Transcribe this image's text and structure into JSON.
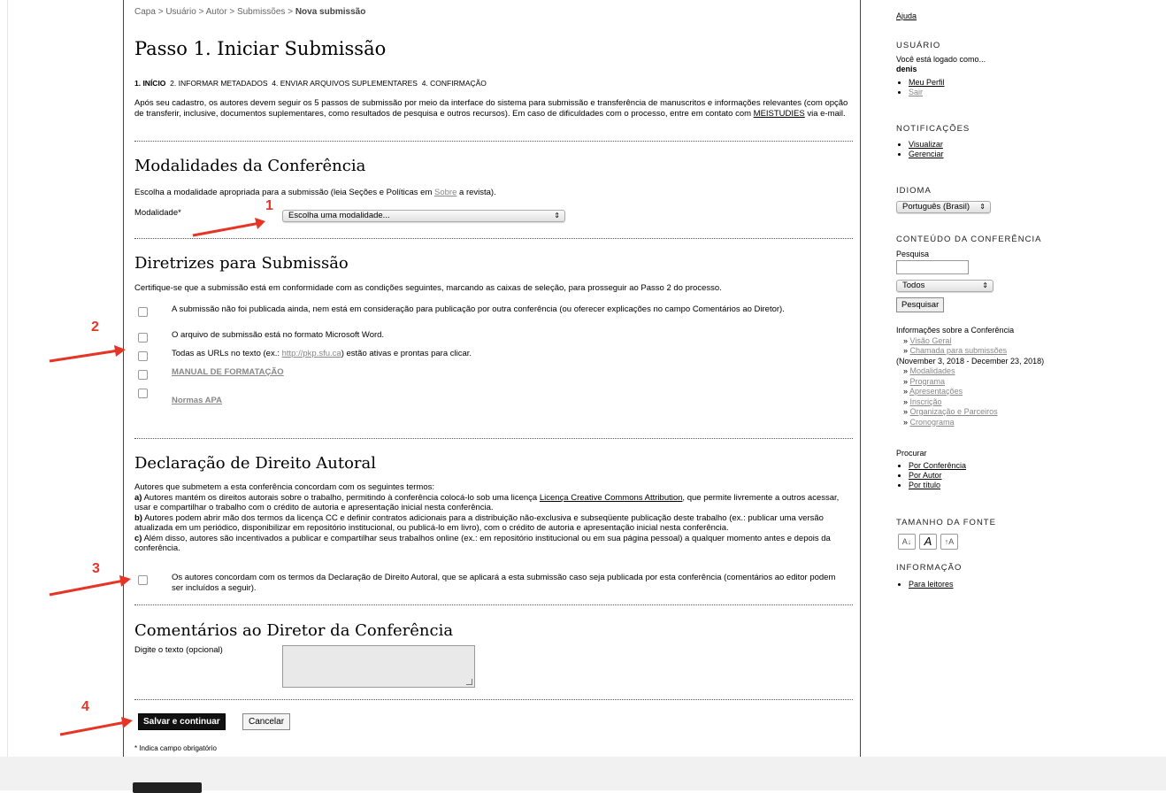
{
  "breadcrumb": {
    "c1": "Capa",
    "c2": "Usuário",
    "c3": "Autor",
    "c4": "Submissões",
    "current": "Nova submissão",
    "sep": ">"
  },
  "title": "Passo 1. Iniciar Submissão",
  "steps": {
    "s1": "1. INÍCIO",
    "s2": "2. INFORMAR METADADOS",
    "s3": "4. ENVIAR ARQUIVOS SUPLEMENTARES",
    "s4": "4. CONFIRMAÇÃO"
  },
  "intro": {
    "text1": "Após seu cadastro, os autores devem seguir os 5 passos de submissão por meio da interface do sistema para submissão e transferência de manuscritos e informações relevantes (com opção de transferir, inclusive, documentos suplementares, como resultados de pesquisa e outros recursos). Em caso de dificuldades com o processo, entre em contato com ",
    "link": "MEISTUDIES",
    "text2": " via e-mail."
  },
  "modalidades": {
    "heading": "Modalidades da Conferência",
    "text1": "Escolha a modalidade apropriada para a submissão (leia Seções e Políticas em ",
    "link": "Sobre",
    "text2": " a revista).",
    "label": "Modalidade*",
    "select_value": "Escolha uma modalidade..."
  },
  "diretrizes": {
    "heading": "Diretrizes para Submissão",
    "text": "Certifique-se que a submissão está em conformidade com as condições seguintes, marcando as caixas de seleção, para prosseguir ao Passo 2 do processo.",
    "item1": "A submissão não foi publicada ainda, nem está em consideração para publicação por outra conferência (ou oferecer explicações no campo Comentários ao Diretor).",
    "item2": "O arquivo de submissão está no formato Microsoft Word.",
    "item3a": "Todas as URLs no texto (ex.: ",
    "item3link": "http://pkp.sfu.ca",
    "item3b": ") estão ativas e prontas para clicar.",
    "item4": "MANUAL DE FORMATAÇÃO",
    "item5": "Normas APA"
  },
  "copyright": {
    "heading": "Declaração de Direito Autoral",
    "intro": "Autores que submetem a esta conferência concordam com os seguintes termos:",
    "a_label": "a)",
    "a_text1": " Autores mantém os direitos autorais sobre o trabalho, permitindo à conferência colocá-lo sob uma licença ",
    "a_link": "Licença Creative Commons Attribution",
    "a_text2": ", que permite livremente a outros acessar, usar e compartilhar o trabalho com o crédito de autoria e apresentação inicial nesta conferência.",
    "b_label": "b)",
    "b_text": " Autores podem abrir mão dos termos da licença CC e definir contratos adicionais para a distribuição não-exclusiva e subseqüente publicação deste trabalho (ex.: publicar uma versão atualizada em um periódico, disponibilizar em repositório institucional, ou publicá-lo em livro), com o crédito de autoria e apresentação inicial nesta conferência.",
    "c_label": "c)",
    "c_text": " Além disso, autores são incentivados a publicar e compartilhar seus trabalhos online (ex.: em repositório institucional ou em sua página pessoal) a qualquer momento antes e depois da conferência.",
    "agree": "Os autores concordam com os termos da Declaração de Direito Autoral, que se aplicará a esta submissão caso seja publicada por esta conferência (comentários ao editor podem ser incluídos a seguir)."
  },
  "comments": {
    "heading": "Comentários ao Diretor da Conferência",
    "label": "Digite o texto (opcional)"
  },
  "buttons": {
    "save": "Salvar e continuar",
    "cancel": "Cancelar"
  },
  "required_note": "* Indica campo obrigatório",
  "annotations": {
    "n1": "1",
    "n2": "2",
    "n3": "3",
    "n4": "4",
    "color": "#e53527"
  },
  "sidebar": {
    "help": "Ajuda",
    "user_head": "USUÁRIO",
    "logged": "Você está logado como...",
    "username": "denis",
    "profile": "Meu Perfil",
    "logout": "Sair",
    "notif_head": "NOTIFICAÇÕES",
    "view": "Visualizar",
    "manage": "Gerenciar",
    "lang_head": "IDIOMA",
    "lang_value": "Português (Brasil)",
    "content_head": "CONTEÚDO DA CONFERÊNCIA",
    "search_label": "Pesquisa",
    "search_scope": "Todos",
    "search_button": "Pesquisar",
    "info_title": "Informações sobre a Conferência",
    "info1": "Visão Geral",
    "info2": "Chamada para submissões",
    "info2_dates": "(November 3, 2018 - December 23, 2018)",
    "info3": "Modalidades",
    "info4": "Programa",
    "info5": "Apresentações",
    "info6": "Inscrição",
    "info7": "Organização e Parceiros",
    "info8": "Cronograma",
    "bullet": "»",
    "browse_title": "Procurar",
    "browse1": "Por Conferência",
    "browse2": "Por Autor",
    "browse3": "Por título",
    "font_head": "TAMANHO DA FONTE",
    "info_head": "INFORMAÇÃO",
    "readers": "Para leitores"
  }
}
